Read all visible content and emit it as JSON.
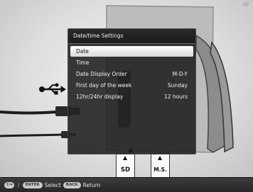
{
  "dialog": {
    "title": "Date/time Settings",
    "items": [
      {
        "label": "Date",
        "value": "",
        "selected": true
      },
      {
        "label": "Time",
        "value": "",
        "selected": false
      },
      {
        "label": "Date Display Order",
        "value": "M-D-Y",
        "selected": false
      },
      {
        "label": "First day of the week",
        "value": "Sunday",
        "selected": false
      },
      {
        "label": "12hr/24hr display",
        "value": "12 hours",
        "selected": false
      }
    ]
  },
  "slots": {
    "sd_label": "SD",
    "ms_label": "M.S."
  },
  "footer": {
    "nav_key": "⇕⇔",
    "divider": "/",
    "enter_key": "ENTER",
    "select_label": "Select",
    "back_key": "BACK",
    "return_label": "Return"
  },
  "colors": {
    "dialog_bg": "#1e1e1e",
    "selected_row": "#ffffff",
    "footer_bg": "#2e2e2e"
  }
}
